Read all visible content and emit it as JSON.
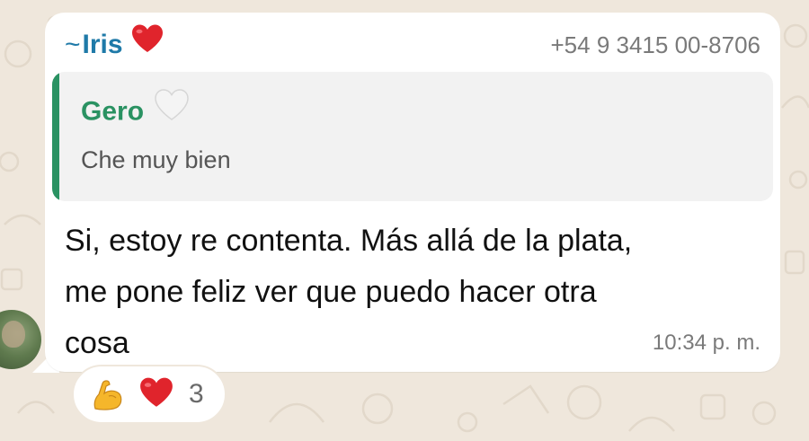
{
  "message": {
    "sender": {
      "prefix": "~",
      "name": "Iris",
      "name_icon": "red-heart-emoji",
      "phone": "+54 9 3415 00-8706",
      "name_color": "#1f7aa8"
    },
    "quoted_reply": {
      "author": "Gero",
      "author_icon": "white-heart-emoji",
      "text": "Che muy bien",
      "accent_color": "#2a9262"
    },
    "text_lines": [
      "Si, estoy re contenta. Más allá de la plata,",
      "me pone feliz ver que puedo hacer otra",
      "cosa"
    ],
    "time": "10:34 p. m."
  },
  "reactions": {
    "emojis": [
      "flexed-biceps-emoji",
      "red-heart-emoji"
    ],
    "count": "3"
  },
  "colors": {
    "chat_background": "#efe7dc",
    "bubble": "#ffffff",
    "quote_background": "#f2f2f2"
  }
}
